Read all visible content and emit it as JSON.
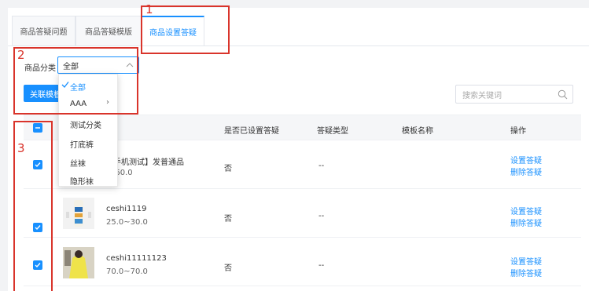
{
  "tabs": [
    {
      "label": "商品答疑问题"
    },
    {
      "label": "商品答疑模版"
    },
    {
      "label": "商品设置答疑"
    }
  ],
  "filter": {
    "label": "商品分类",
    "selected": "全部"
  },
  "dropdown": {
    "items": [
      {
        "label": "全部",
        "checked": true
      },
      {
        "label": "AAA",
        "has_children": true
      },
      {
        "label": "测试分类"
      },
      {
        "label": "打底裤"
      },
      {
        "label": "丝袜"
      },
      {
        "label": "隐形袜"
      }
    ]
  },
  "toolbar": {
    "button_label": "关联模板",
    "search_placeholder": "搜索关键词"
  },
  "table": {
    "headers": [
      "是否已设置答疑",
      "答疑类型",
      "模板名称",
      "操作"
    ],
    "rows": [
      {
        "name": "【手机测试】发普通品",
        "price": "~60.0",
        "is_set": "否",
        "type": "--",
        "action1": "设置答疑",
        "action2": "删除答疑"
      },
      {
        "name": "ceshi1119",
        "price": "25.0~30.0",
        "is_set": "否",
        "type": "--",
        "action1": "设置答疑",
        "action2": "删除答疑"
      },
      {
        "name": "ceshi11111123",
        "price": "70.0~70.0",
        "is_set": "否",
        "type": "--",
        "action1": "设置答疑",
        "action2": "删除答疑"
      }
    ]
  },
  "annotations": [
    "1",
    "2",
    "3"
  ],
  "colors": {
    "accent": "#1890ff",
    "annotation": "#d9342b"
  }
}
